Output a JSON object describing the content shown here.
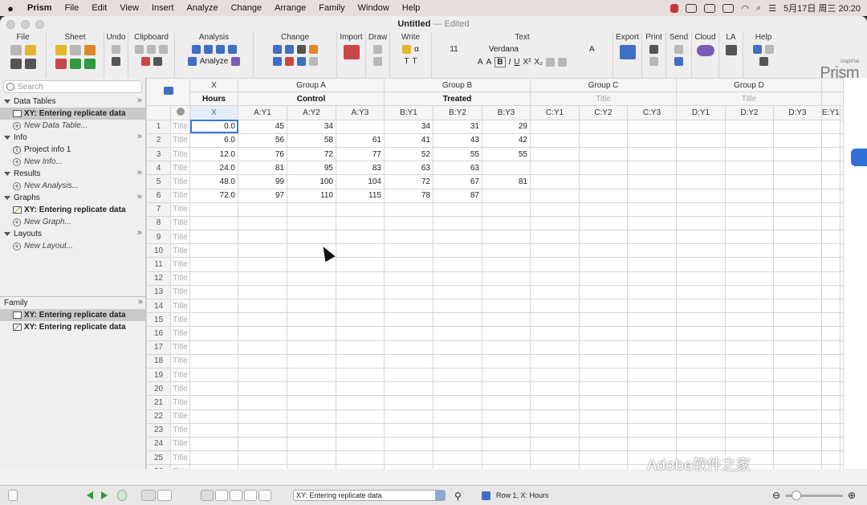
{
  "menubar": {
    "app": "Prism",
    "items": [
      "File",
      "Edit",
      "View",
      "Insert",
      "Analyze",
      "Change",
      "Arrange",
      "Family",
      "Window",
      "Help"
    ],
    "clock": "5月17日 周三 20:20"
  },
  "window": {
    "title": "Untitled",
    "status": "— Edited"
  },
  "toolbar": {
    "groups": [
      "File",
      "Sheet",
      "Undo",
      "Clipboard",
      "Analysis",
      "Change",
      "Import",
      "Draw",
      "Write",
      "Text",
      "Export",
      "Print",
      "Send",
      "Cloud",
      "LA",
      "Help"
    ],
    "analyze_label": "Analyze",
    "font_size": "11",
    "font_name": "Verdana",
    "logo": "Prism",
    "logo_small": "GraphPad"
  },
  "sidebar": {
    "search_placeholder": "Search",
    "sections": [
      {
        "label": "Data Tables",
        "items": [
          "XY: Entering replicate data",
          "New Data Table..."
        ]
      },
      {
        "label": "Info",
        "items": [
          "Project info 1",
          "New Info..."
        ]
      },
      {
        "label": "Results",
        "items": [
          "New Analysis..."
        ]
      },
      {
        "label": "Graphs",
        "items": [
          "XY: Entering replicate data",
          "New Graph..."
        ]
      },
      {
        "label": "Layouts",
        "items": [
          "New Layout..."
        ]
      }
    ],
    "family_label": "Family",
    "family_items": [
      "XY: Entering replicate data",
      "XY: Entering replicate data"
    ]
  },
  "table": {
    "group_headers": [
      "X",
      "Group A",
      "Group B",
      "Group C",
      "Group D"
    ],
    "title_row": [
      "Hours",
      "Control",
      "Treated",
      "Title",
      "Title"
    ],
    "col_headers": [
      "X",
      "A:Y1",
      "A:Y2",
      "A:Y3",
      "B:Y1",
      "B:Y2",
      "B:Y3",
      "C:Y1",
      "C:Y2",
      "C:Y3",
      "D:Y1",
      "D:Y2",
      "D:Y3",
      "E:Y1"
    ],
    "row_title": "Title",
    "rows": [
      [
        "0.0",
        "45",
        "34",
        "",
        "34",
        "31",
        "29"
      ],
      [
        "6.0",
        "56",
        "58",
        "61",
        "41",
        "43",
        "42"
      ],
      [
        "12.0",
        "76",
        "72",
        "77",
        "52",
        "55",
        "55"
      ],
      [
        "24.0",
        "81",
        "95",
        "83",
        "63",
        "63",
        ""
      ],
      [
        "48.0",
        "99",
        "100",
        "104",
        "72",
        "67",
        "81"
      ],
      [
        "72.0",
        "97",
        "110",
        "115",
        "78",
        "87",
        ""
      ]
    ],
    "row_count": 26
  },
  "statusbar": {
    "sheet_name": "XY: Entering replicate data",
    "position": "Row 1, X: Hours"
  },
  "watermark": "Adobe软件之家"
}
